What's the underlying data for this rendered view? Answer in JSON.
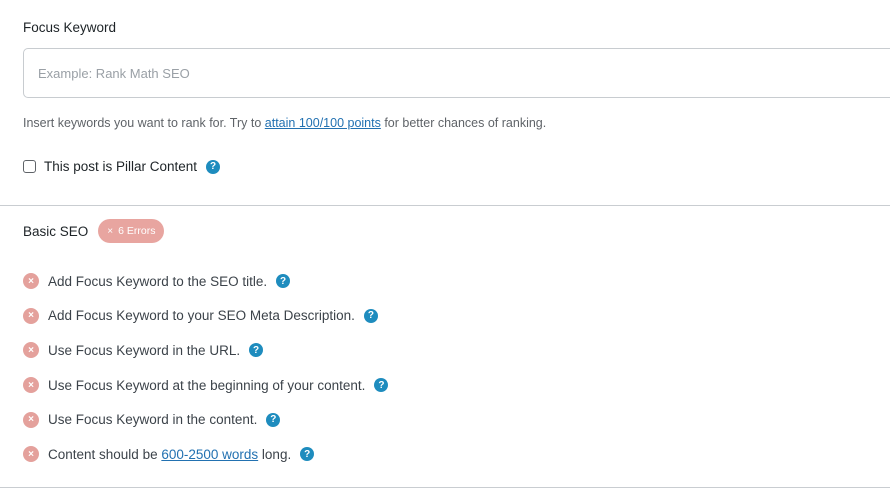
{
  "focus_keyword": {
    "label": "Focus Keyword",
    "placeholder": "Example: Rank Math SEO",
    "value": "",
    "help_prefix": "Insert keywords you want to rank for. Try to ",
    "help_link": "attain 100/100 points",
    "help_suffix": " for better chances of ranking."
  },
  "pillar": {
    "label": "This post is Pillar Content",
    "checked": false,
    "help_icon": "question-circle-icon"
  },
  "basic_seo": {
    "title": "Basic SEO",
    "badge_icon": "×",
    "badge_text": "6 Errors",
    "checks": [
      {
        "text": "Add Focus Keyword to the SEO title."
      },
      {
        "text": "Add Focus Keyword to your SEO Meta Description."
      },
      {
        "text": "Use Focus Keyword in the URL."
      },
      {
        "text": "Use Focus Keyword at the beginning of your content."
      },
      {
        "text": "Use Focus Keyword in the content."
      },
      {
        "prefix": "Content should be ",
        "link": "600-2500 words",
        "suffix": " long."
      }
    ]
  },
  "icons": {
    "error": "×",
    "help": "?"
  },
  "colors": {
    "link": "#2271b1",
    "help_icon": "#1e8cbe",
    "error_icon": "#e4a19c",
    "error_badge": "#e8a5a0"
  }
}
